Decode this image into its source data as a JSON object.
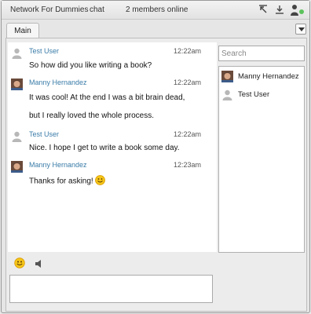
{
  "window": {
    "title": "Network For Dummies",
    "chat_label": "chat",
    "members_status": "2 members online"
  },
  "tabs": [
    {
      "label": "Main"
    }
  ],
  "messages": [
    {
      "sender": "Test User",
      "time": "12:22am",
      "avatar": "default-user-avatar",
      "lines": [
        "So how did you like writing a book?"
      ]
    },
    {
      "sender": "Manny Hernandez",
      "time": "12:22am",
      "avatar": "photo-avatar",
      "lines": [
        "It was cool! At the end I was a bit brain dead,",
        "but I really loved the whole process."
      ]
    },
    {
      "sender": "Test User",
      "time": "12:22am",
      "avatar": "default-user-avatar",
      "lines": [
        "Nice. I hope I get to write a book some day."
      ]
    },
    {
      "sender": "Manny Hernandez",
      "time": "12:23am",
      "avatar": "photo-avatar",
      "lines": [
        "Thanks for asking!"
      ],
      "emoticon": "smiley-icon"
    }
  ],
  "sidebar": {
    "search_placeholder": "Search",
    "users": [
      {
        "name": "Manny Hernandez",
        "avatar": "photo-avatar"
      },
      {
        "name": "Test User",
        "avatar": "default-user-avatar"
      }
    ]
  },
  "composer": {
    "value": "",
    "emoticon_button": "smiley-icon",
    "sound_button": "speaker-icon"
  },
  "colors": {
    "sender_name": "#3a7ca8",
    "presence_online": "#5cc35c"
  }
}
